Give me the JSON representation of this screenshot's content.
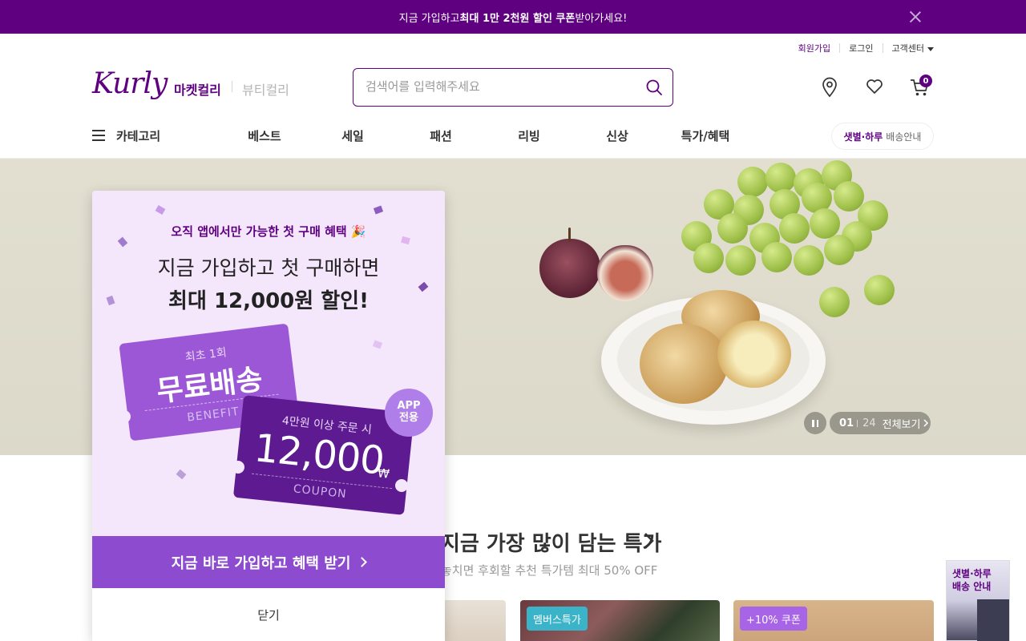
{
  "top_banner": {
    "prefix": "지금 가입하고 ",
    "highlight": "최대 1만 2천원 할인 쿠폰",
    "suffix": " 받아가세요!"
  },
  "util": {
    "join": "회원가입",
    "login": "로그인",
    "cs": "고객센터"
  },
  "header": {
    "logo": "Kurly",
    "market": "마켓컬리",
    "beauty": "뷰티컬리",
    "search_placeholder": "검색어를 입력해주세요",
    "cart_count": "0"
  },
  "nav": {
    "category": "카테고리",
    "items": [
      "베스트",
      "세일",
      "패션",
      "리빙",
      "신상",
      "특가/혜택"
    ],
    "delivery_strong": "샛별·하루",
    "delivery_rest": "배송안내"
  },
  "hero": {
    "current": "01",
    "total": "24",
    "view_all": "전체보기"
  },
  "section": {
    "title": "지금 가장 많이 담는 특가",
    "subtitle": "놓치면 후회할 추천 특가템 최대 50% OFF"
  },
  "cards": [
    {
      "tag": ""
    },
    {
      "tag": "멤버스특가"
    },
    {
      "tag": "+10% 쿠폰"
    }
  ],
  "side_banner": {
    "line1": "샛별·하루",
    "line2": "배송 안내"
  },
  "popup": {
    "line1": "오직 앱에서만 가능한 첫 구매 혜택 🎉",
    "line2": "지금 가입하고 첫 구매하면",
    "line3": "최대 12,000원 할인!",
    "ticket1": {
      "top": "최초 1회",
      "main": "무료배송",
      "bottom": "BENEFIT"
    },
    "ticket2": {
      "top": "4만원 이상 주문 시",
      "amount": "12,000",
      "won": "₩",
      "bottom": "COUPON"
    },
    "app_badge_1": "APP",
    "app_badge_2": "전용",
    "cta": "지금 바로 가입하고 혜택 받기",
    "close": "닫기"
  },
  "colors": {
    "brand": "#5f0080",
    "popup_bg": "#f4e6fb",
    "cta": "#8d4bd0"
  }
}
